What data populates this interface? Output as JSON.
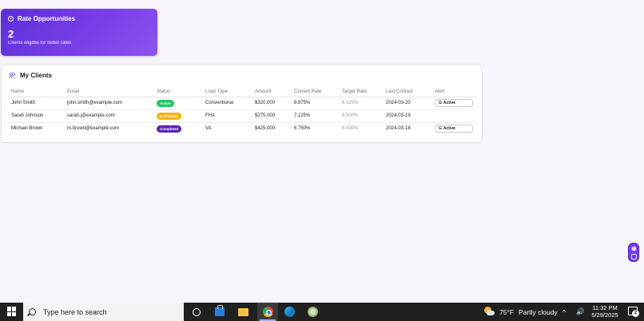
{
  "rate_card": {
    "title": "Rate Opportunities",
    "count": "2",
    "subtitle": "Clients eligible for better rates"
  },
  "clients": {
    "title": "My Clients",
    "columns": [
      "Name",
      "Email",
      "Status",
      "Loan Type",
      "Amount",
      "Current Rate",
      "Target Rate",
      "Last Contact",
      "Alert"
    ],
    "rows": [
      {
        "name": "John Smith",
        "email": "john.smith@example.com",
        "status": "Active",
        "loan_type": "Conventional",
        "amount": "$320,000",
        "current_rate": "6.875%",
        "target_rate": "6.125%",
        "last_contact": "2024-03-20",
        "alert": "Active"
      },
      {
        "name": "Sarah Johnson",
        "email": "sarah.j@example.com",
        "status": "In Process",
        "loan_type": "FHA",
        "amount": "$275,000",
        "current_rate": "7.125%",
        "target_rate": "6.500%",
        "last_contact": "2024-03-19",
        "alert": ""
      },
      {
        "name": "Michael Brown",
        "email": "m.brown@example.com",
        "status": "Completed",
        "loan_type": "VA",
        "amount": "$425,000",
        "current_rate": "6.750%",
        "target_rate": "6.000%",
        "last_contact": "2024-03-18",
        "alert": "Active"
      }
    ],
    "alert_icon_letter": "G"
  },
  "taskbar": {
    "search_placeholder": "Type here to search",
    "weather_temp": "75°F",
    "weather_desc": "Partly cloudy",
    "time": "11:32 PM",
    "date": "5/29/2025",
    "notification_count": "2",
    "chevron": "^"
  },
  "colors": {
    "accent": "#6b3ee8",
    "active_badge": "#22c55e",
    "in_process_badge": "#f5b50a",
    "completed_badge": "#5b21b6",
    "taskbar": "#202020"
  }
}
